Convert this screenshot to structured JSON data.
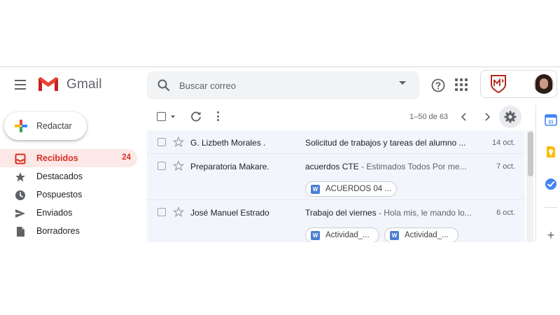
{
  "header": {
    "brand": "Gmail",
    "search_placeholder": "Buscar correo"
  },
  "compose": {
    "label": "Redactar"
  },
  "sidebar": {
    "items": [
      {
        "label": "Recibidos",
        "count": "24",
        "icon": "inbox-icon",
        "active": true
      },
      {
        "label": "Destacados",
        "icon": "star-icon"
      },
      {
        "label": "Pospuestos",
        "icon": "clock-icon"
      },
      {
        "label": "Enviados",
        "icon": "send-icon"
      },
      {
        "label": "Borradores",
        "icon": "draft-icon"
      }
    ]
  },
  "toolbar": {
    "pager": "1–50 de 63"
  },
  "messages": [
    {
      "sender": "G. Lizbeth Morales .",
      "subject": "Solicitud de trabajos y tareas del alumno ...",
      "snippet": "",
      "date": "14 oct."
    },
    {
      "sender": "Preparatoria Makare.",
      "subject": "acuerdos CTE",
      "snippet": " - Estimados Todos Por me...",
      "date": "7 oct.",
      "attachments": [
        "ACUERDOS 04 ..."
      ]
    },
    {
      "sender": "José Manuel Estrado",
      "subject": "Trabajo del viernes",
      "snippet": " - Hola mis, le mando lo...",
      "date": "6 oct.",
      "attachments": [
        "Actividad_...",
        "Actividad_..."
      ]
    }
  ],
  "colors": {
    "accent_red": "#d93025",
    "active_bg": "#fce8e6",
    "list_bg": "#f2f6fc",
    "doc_blue": "#4a7fd4"
  }
}
